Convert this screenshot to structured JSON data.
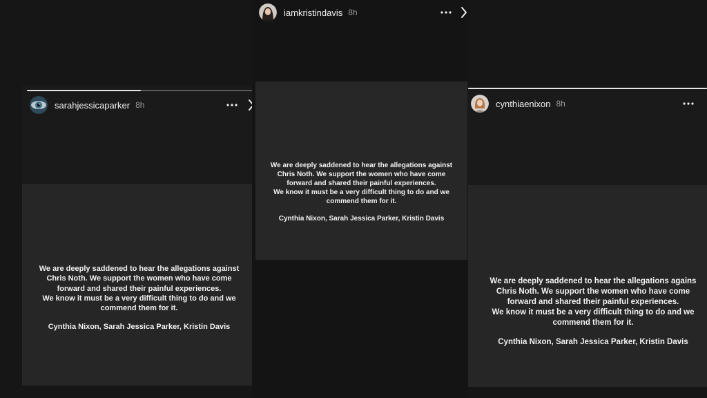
{
  "stories": [
    {
      "username": "sarahjessicaparker",
      "time": "8h",
      "progress_fraction": 0.5,
      "message": {
        "line1": "We are deeply saddened to hear the allegations against",
        "line2": "Chris Noth. We support the women who have come",
        "line3": "forward and shared their painful experiences.",
        "line4": "We know it must be a very difficult thing to do and we",
        "line5": "commend them for it.",
        "signature": "Cynthia Nixon, Sarah Jessica Parker, Kristin Davis"
      },
      "icons": {
        "avatar": "eye-avatar",
        "more": "more-horizontal-icon",
        "next": "chevron-right-icon"
      }
    },
    {
      "username": "iamkristindavis",
      "time": "8h",
      "message": {
        "line1": "We are deeply saddened to hear the allegations against",
        "line2": "Chris Noth. We support the women who have come",
        "line3": "forward and shared their painful experiences.",
        "line4": "We know it must be a very difficult thing to do and we",
        "line5": "commend them for it.",
        "signature": "Cynthia Nixon, Sarah Jessica Parker, Kristin Davis"
      },
      "icons": {
        "avatar": "portrait-avatar",
        "more": "more-horizontal-icon",
        "next": "chevron-right-icon"
      }
    },
    {
      "username": "cynthiaenixon",
      "time": "8h",
      "progress_fraction": 1.0,
      "message": {
        "line1": "We are deeply saddened to hear the allegations agains",
        "line2": "Chris Noth. We support the women who have come",
        "line3": "forward and shared their painful experiences.",
        "line4": "We know it must be a very difficult thing to do and we",
        "line5": "commend them for it.",
        "signature": "Cynthia Nixon, Sarah Jessica Parker, Kristin Davis"
      },
      "icons": {
        "avatar": "portrait-avatar",
        "more": "more-horizontal-icon"
      }
    }
  ],
  "colors": {
    "background": "#161616",
    "panel": "#1a1a1a",
    "message_box": "#262626",
    "text": "#f2f2f2",
    "secondary_text": "#9c9c9c",
    "progress_track": "#5a5a5a",
    "progress_fill": "#e6e6e6"
  }
}
